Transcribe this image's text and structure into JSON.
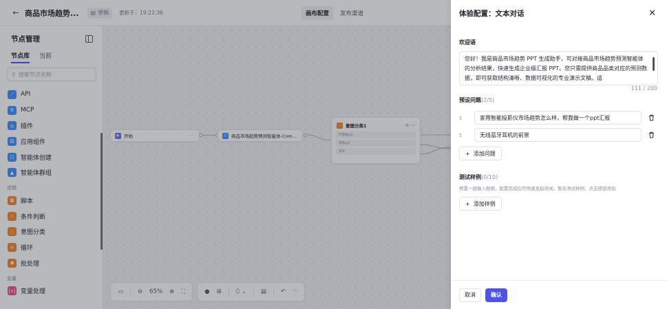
{
  "colors": {
    "accent": "#4d53e8",
    "node_blue": "#3f8cff",
    "node_orange": "#f5842c",
    "node_indigo": "#6770f0"
  },
  "topbar": {
    "back_icon": "arrow-left-icon",
    "title": "商品市场趋势...",
    "draft_label": "草稿",
    "updated": "更新于：19:22:36",
    "tabs": [
      "画布配置",
      "发布渠道"
    ]
  },
  "left_panel": {
    "title": "节点管理",
    "tabs": [
      "节点库",
      "当前"
    ],
    "search_placeholder": "搜索节点名称",
    "items": [
      {
        "label": "API",
        "icon": "api-icon",
        "color": "#3f8cff"
      },
      {
        "label": "MCP",
        "icon": "mcp-icon",
        "color": "#3f8cff"
      },
      {
        "label": "插件",
        "icon": "plugin-icon",
        "color": "#3f8cff"
      },
      {
        "label": "应用组件",
        "icon": "component-icon",
        "color": "#3f8cff"
      },
      {
        "label": "智能体创建",
        "icon": "agent-create-icon",
        "color": "#3f8cff"
      },
      {
        "label": "智能体群组",
        "icon": "agent-group-icon",
        "color": "#3f8cff"
      }
    ],
    "section_logic": "逻辑",
    "logic_items": [
      {
        "label": "脚本",
        "icon": "script-icon",
        "color": "#f5842c"
      },
      {
        "label": "条件判断",
        "icon": "condition-icon",
        "color": "#f5842c"
      },
      {
        "label": "意图分类",
        "icon": "intent-icon",
        "color": "#f5842c"
      },
      {
        "label": "循环",
        "icon": "loop-icon",
        "color": "#f5842c"
      },
      {
        "label": "批处理",
        "icon": "batch-icon",
        "color": "#f5842c"
      }
    ],
    "section_variable": "变量",
    "variable_items": [
      {
        "label": "变量处理",
        "icon": "variable-icon",
        "color": "#e8508a"
      }
    ]
  },
  "canvas": {
    "start_node": "开始",
    "agent_node": "商品市场趋势预测智能体-Com...",
    "intent_node": {
      "title": "意图分类1",
      "rows": [
        "不需要ppt",
        "需要ppt",
        "其他"
      ]
    },
    "zoom": "65%"
  },
  "drawer": {
    "title": "体验配置：文本对话",
    "welcome_label": "欢迎语",
    "welcome_text": "您好！我是商品市场趋势 PPT 生成助手，可对接商品市场趋势预测智能体的分析结果，快速生成企业级汇报 PPT。您只需提供商品品类对应的预测数据，即可获取结构清晰、数据可视化的专业演示文稿，适",
    "char_count": "111 / 200",
    "preset_label": "预设问题",
    "preset_count": "(2/5)",
    "questions": [
      "家用智能投影仪市场趋势怎么样，帮我做一个ppt汇报",
      "无线蓝牙耳机的前景"
    ],
    "add_question": "添加问题",
    "sample_label": "测试样例",
    "sample_count": "(0/10)",
    "sample_hint": "预置一组输入数据，配置完成后可快速发起测试。暂无测试样例，点击按钮添加",
    "add_sample": "添加样例",
    "cancel": "取消",
    "confirm": "确认"
  }
}
